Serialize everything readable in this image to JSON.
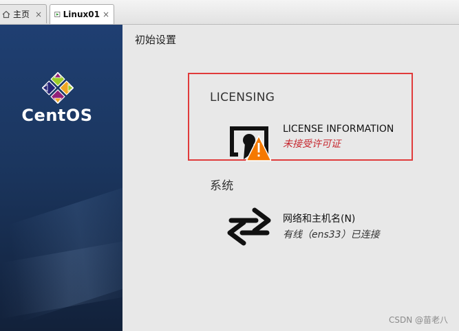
{
  "tabs": [
    {
      "label": "主页",
      "icon": "home-icon",
      "active": false
    },
    {
      "label": "Linux01",
      "icon": "vm-icon",
      "active": true
    }
  ],
  "tab_close_glyph": "×",
  "sidebar": {
    "logo_text": "CentOS"
  },
  "page_title": "初始设置",
  "sections": [
    {
      "heading": "LICENSING",
      "items": [
        {
          "title": "LICENSE INFORMATION",
          "status": "未接受许可证",
          "status_kind": "error",
          "icon": "license-warning-icon"
        }
      ]
    },
    {
      "heading": "系统",
      "items": [
        {
          "title": "网络和主机名(N)",
          "status": "有线（ens33）已连接",
          "status_kind": "normal",
          "icon": "network-arrows-icon"
        }
      ]
    }
  ],
  "watermark": "CSDN @苗老八",
  "colors": {
    "highlight_border": "#e03a3a",
    "error_text": "#c6262e",
    "sidebar_top": "#1f3f72",
    "sidebar_bottom": "#12213a",
    "warning": "#f57900"
  }
}
